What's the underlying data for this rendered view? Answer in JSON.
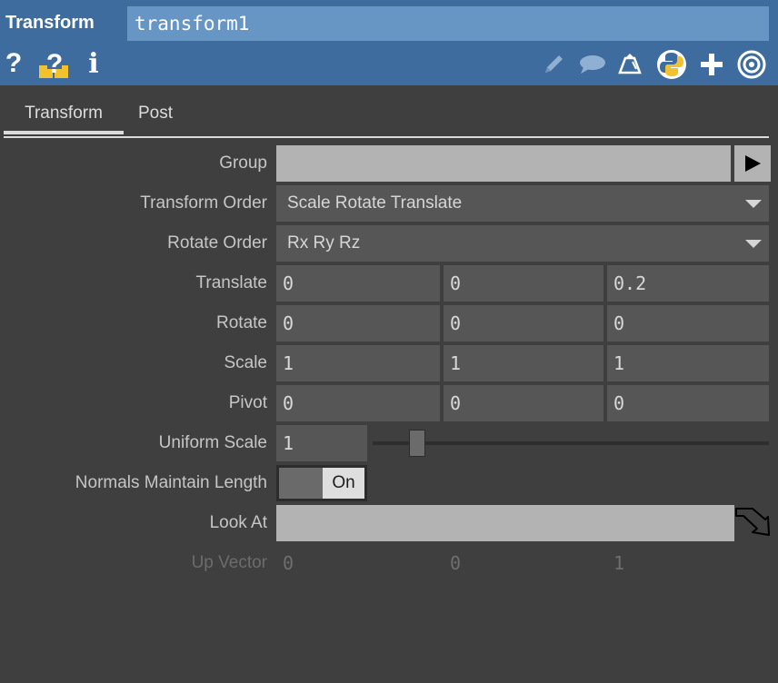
{
  "header": {
    "op_type": "Transform",
    "op_name": "transform1",
    "left_icons": [
      {
        "name": "help-icon",
        "glyph": "?"
      },
      {
        "name": "python-help-icon",
        "glyph": "?"
      },
      {
        "name": "info-icon",
        "glyph": "i"
      }
    ],
    "right_icons": [
      "pencil-icon",
      "comment-icon",
      "clone-icon",
      "python-icon",
      "add-icon",
      "target-icon"
    ]
  },
  "tabs": [
    {
      "label": "Transform",
      "active": true
    },
    {
      "label": "Post",
      "active": false
    }
  ],
  "params": {
    "group": {
      "label": "Group",
      "value": ""
    },
    "transform_order": {
      "label": "Transform Order",
      "value": "Scale Rotate Translate"
    },
    "rotate_order": {
      "label": "Rotate Order",
      "value": "Rx Ry Rz"
    },
    "translate": {
      "label": "Translate",
      "values": [
        "0",
        "0",
        "0.2"
      ]
    },
    "rotate": {
      "label": "Rotate",
      "values": [
        "0",
        "0",
        "0"
      ]
    },
    "scale": {
      "label": "Scale",
      "values": [
        "1",
        "1",
        "1"
      ]
    },
    "pivot": {
      "label": "Pivot",
      "values": [
        "0",
        "0",
        "0"
      ]
    },
    "uniform_scale": {
      "label": "Uniform Scale",
      "value": "1"
    },
    "normals_maintain_length": {
      "label": "Normals Maintain Length",
      "state": "On"
    },
    "look_at": {
      "label": "Look At",
      "value": ""
    },
    "up_vector": {
      "label": "Up Vector",
      "values": [
        "0",
        "0",
        "1"
      ]
    }
  },
  "colors": {
    "header_bg": "#3f6c9f",
    "name_field_bg": "#6796c4",
    "panel_bg": "#3f3f3f",
    "field_bg": "#565656",
    "light_field_bg": "#b3b3b3"
  }
}
